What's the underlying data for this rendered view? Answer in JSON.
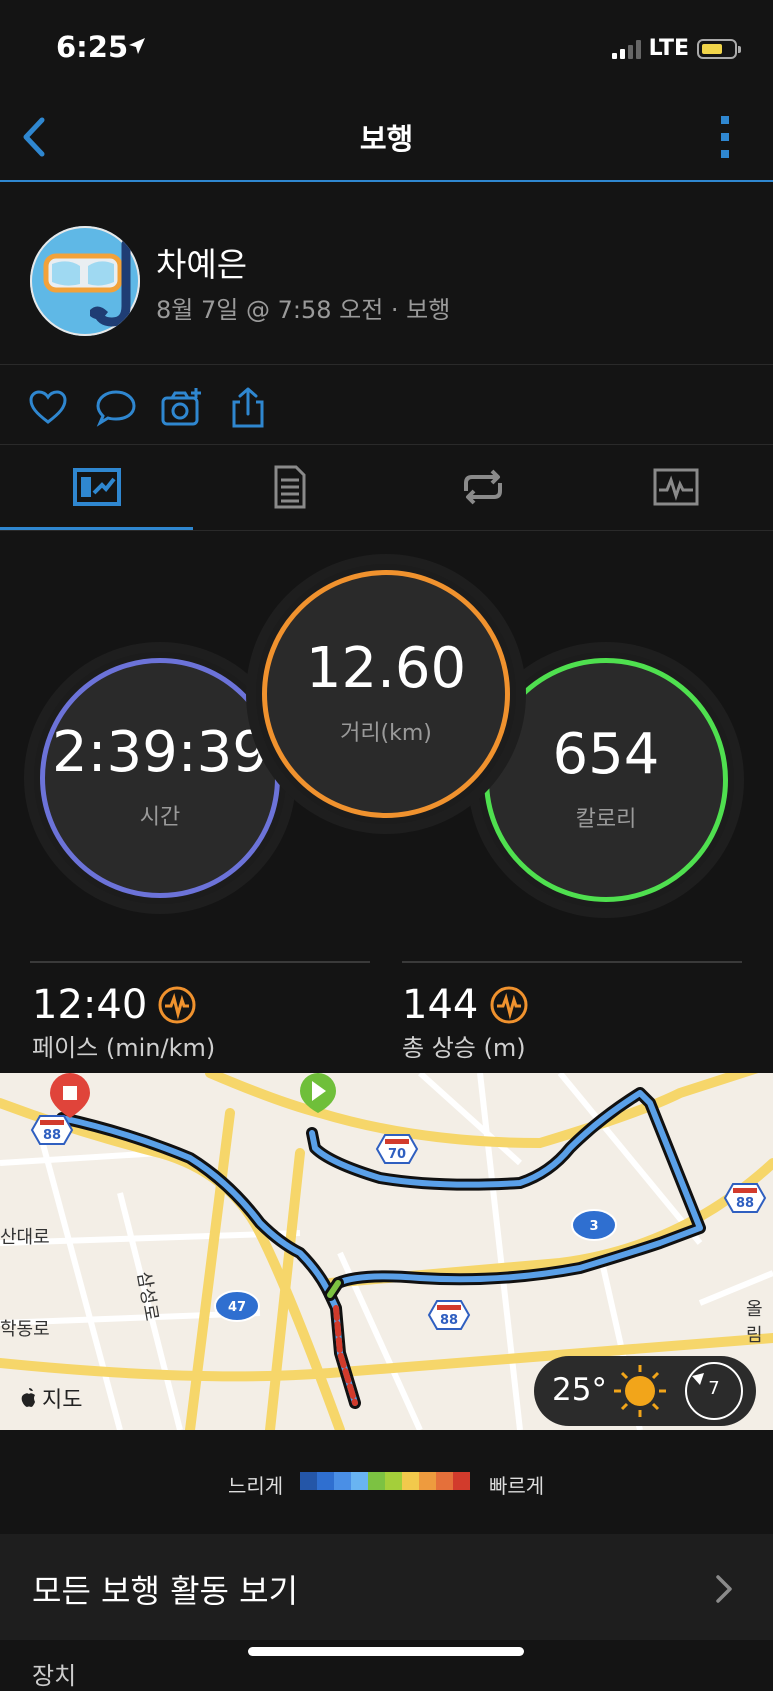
{
  "status_bar": {
    "time": "6:25",
    "network": "LTE",
    "icons": [
      "location-arrow-icon",
      "signal-icon",
      "battery-icon"
    ]
  },
  "nav": {
    "title": "보행",
    "back_icon": "chevron-left-icon",
    "more_icon": "more-vertical-icon"
  },
  "profile": {
    "name": "차예은",
    "meta": "8월 7일 @ 7:58 오전 · 보행"
  },
  "actions": [
    "heart-icon",
    "comment-icon",
    "camera-add-icon",
    "share-icon"
  ],
  "tabs": [
    {
      "icon": "overview-icon",
      "active": true
    },
    {
      "icon": "details-icon",
      "active": false
    },
    {
      "icon": "laps-icon",
      "active": false
    },
    {
      "icon": "chart-icon",
      "active": false
    }
  ],
  "metrics": {
    "time": {
      "value": "2:39:39",
      "label": "시간",
      "color": "#7b6fd8"
    },
    "distance": {
      "value": "12.60",
      "label": "거리(km)",
      "color": "#f0922e"
    },
    "calories": {
      "value": "654",
      "label": "칼로리",
      "color": "#4fe04f"
    }
  },
  "stats": {
    "pace": {
      "value": "12:40",
      "label": "페이스 (min/km)"
    },
    "ascent": {
      "value": "144",
      "label": "총 상승 (m)"
    }
  },
  "map": {
    "credit": "지도",
    "road_labels": {
      "sandae": "산대로",
      "hakdong": "학동로",
      "samseong": "삼성로",
      "olim": "올림"
    },
    "route_shields": [
      "88",
      "70",
      "88",
      "3",
      "47",
      "88"
    ],
    "weather": {
      "temperature": "25°",
      "wind": "7"
    }
  },
  "legend": {
    "slow": "느리게",
    "fast": "빠르게",
    "colors": [
      "#2456a8",
      "#2f6fd0",
      "#4a8fe6",
      "#69b4f2",
      "#7cc242",
      "#a4cf3a",
      "#f2c94c",
      "#ee9b3e",
      "#e5703a",
      "#d23b2c"
    ]
  },
  "footer": {
    "all_activities": "모든 보행 활동 보기",
    "next_section": "장치"
  }
}
